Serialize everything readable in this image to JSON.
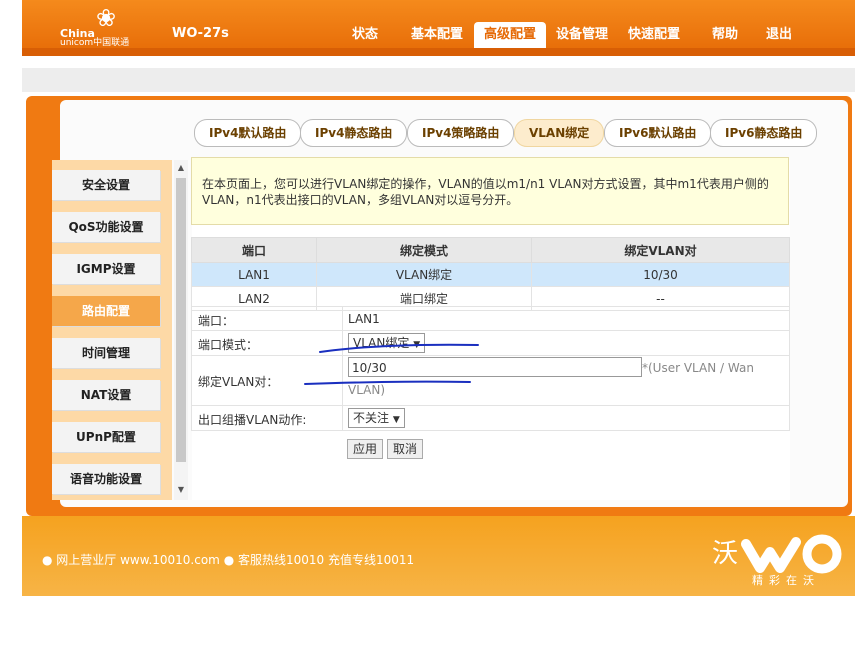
{
  "header": {
    "brand_cn": "China",
    "brand_en": "unicom中国联通",
    "model": "WO-27s",
    "nav": [
      "状态",
      "基本配置",
      "高级配置",
      "设备管理",
      "快速配置",
      "帮助",
      "退出"
    ],
    "active_nav": "高级配置"
  },
  "tabs": [
    "IPv4默认路由",
    "IPv4静态路由",
    "IPv4策略路由",
    "VLAN绑定",
    "IPv6默认路由",
    "IPv6静态路由"
  ],
  "sidebar": [
    "安全设置",
    "QoS功能设置",
    "IGMP设置",
    "路由配置",
    "时间管理",
    "NAT设置",
    "UPnP配置",
    "语音功能设置"
  ],
  "notice": "在本页面上，您可以进行VLAN绑定的操作，VLAN的值以m1/n1 VLAN对方式设置，其中m1代表用户侧的VLAN，n1代表出接口的VLAN，多组VLAN对以逗号分开。",
  "table": {
    "headers": [
      "端口",
      "绑定模式",
      "绑定VLAN对"
    ],
    "rows": [
      [
        "LAN1",
        "VLAN绑定",
        "10/30"
      ],
      [
        "LAN2",
        "端口绑定",
        "--"
      ]
    ]
  },
  "form": {
    "port_label": "端口：",
    "port_value": "LAN1",
    "mode_label": "端口模式：",
    "mode_value": "VLAN绑定",
    "vlan_label": "绑定VLAN对：",
    "vlan_value": "10/30",
    "vlan_hint": "*(User VLAN / Wan VLAN)",
    "multicast_label": "出口组播VLAN动作:",
    "multicast_value": "不关注",
    "apply": "应用",
    "cancel": "取消"
  },
  "footer": {
    "links": "● 网上营业厅  www.10010.com ● 客服热线10010  充值专线10011",
    "slogan": "精彩在沃"
  },
  "colors": {
    "brand_orange": "#f07a12",
    "sidebar_bg": "#fdd9a6",
    "selected_row": "#cfe7fb",
    "ink_blue": "#1a2fbf"
  }
}
